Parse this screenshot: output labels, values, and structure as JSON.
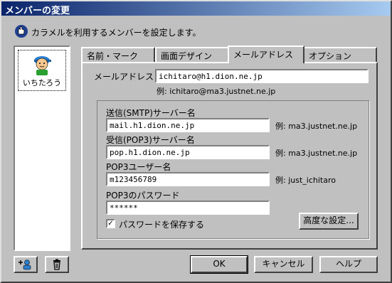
{
  "window": {
    "title": "メンバーの変更"
  },
  "hint": {
    "text": "カラメルを利用するメンバーを設定します。",
    "icon": "hand-pointer-icon"
  },
  "members": [
    {
      "name": "いちたろう",
      "icon": "boy-avatar-icon"
    }
  ],
  "tabs": [
    {
      "label": "名前・マーク"
    },
    {
      "label": "画面デザイン"
    },
    {
      "label": "メールアドレス"
    },
    {
      "label": "オプション"
    }
  ],
  "active_tab": "メールアドレス",
  "mail": {
    "address_label": "メールアドレス",
    "address_value": "ichitaro@h1.dion.ne.jp",
    "address_example": "例: ichitaro@ma3.justnet.ne.jp"
  },
  "smtp": {
    "label": "送信(SMTP)サーバー名",
    "value": "mail.h1.dion.ne.jp",
    "example": "例: ma3.justnet.ne.jp"
  },
  "pop3": {
    "label": "受信(POP3)サーバー名",
    "value": "pop.h1.dion.ne.jp",
    "example": "例: ma3.justnet.ne.jp"
  },
  "user": {
    "label": "POP3ユーザー名",
    "value": "m123456789",
    "example": "例: just_ichitaro"
  },
  "password": {
    "label": "POP3のパスワード",
    "value": "******"
  },
  "save_password": {
    "label": "パスワードを保存する",
    "checked": true
  },
  "advanced_button": "高度な設定...",
  "footer": {
    "add_member_icon": "add-member-icon",
    "delete_icon": "trash-icon",
    "ok": "OK",
    "cancel": "キャンセル",
    "help": "ヘルプ"
  },
  "colors": {
    "title_start": "#0a246a",
    "title_end": "#a6caf0",
    "face": "#c0c0c0"
  }
}
